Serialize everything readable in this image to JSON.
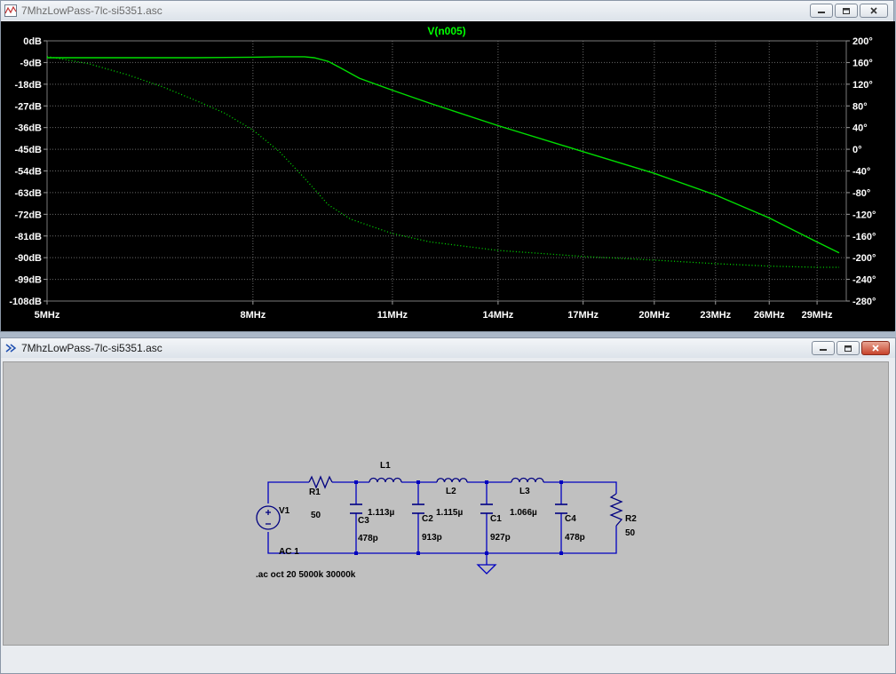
{
  "plot_window": {
    "title": "7MhzLowPass-7lc-si5351.asc",
    "trace_name": "V(n005)"
  },
  "schematic_window": {
    "title": "7MhzLowPass-7lc-si5351.asc"
  },
  "chart_data": {
    "type": "line",
    "title": "V(n005)",
    "x_scale": "log",
    "xlim_mhz": [
      5,
      31
    ],
    "x_ticks": [
      "5MHz",
      "8MHz",
      "11MHz",
      "14MHz",
      "17MHz",
      "20MHz",
      "23MHz",
      "26MHz",
      "29MHz"
    ],
    "y_left_ticks": [
      "0dB",
      "-9dB",
      "-18dB",
      "-27dB",
      "-36dB",
      "-45dB",
      "-54dB",
      "-63dB",
      "-72dB",
      "-81dB",
      "-90dB",
      "-99dB",
      "-108dB"
    ],
    "y_right_ticks": [
      "200°",
      "160°",
      "120°",
      "80°",
      "40°",
      "0°",
      "-40°",
      "-80°",
      "-120°",
      "-160°",
      "-200°",
      "-240°",
      "-280°"
    ],
    "ylim_db": [
      -108,
      0
    ],
    "ylim_deg": [
      -280,
      200
    ],
    "grid": true,
    "colors": {
      "background": "#000000",
      "grid": "#6a6a6a",
      "trace": "#00dd00",
      "text": "#ffffff",
      "title": "#00ff00"
    },
    "series": [
      {
        "style": "solid",
        "x_mhz": [
          5,
          6,
          7,
          8,
          8.5,
          9,
          9.2,
          9.5,
          9.8,
          10.2,
          11,
          12,
          14,
          17,
          20,
          23,
          26,
          29,
          30.5
        ],
        "y_db": [
          -7,
          -7,
          -7,
          -6.8,
          -6.6,
          -6.6,
          -7,
          -8.5,
          -11.5,
          -15.5,
          -20.5,
          -26,
          -35.2,
          -46,
          -55,
          -64,
          -73.5,
          -83.5,
          -88
        ]
      },
      {
        "style": "dotted",
        "x_mhz": [
          5,
          5.5,
          6,
          6.5,
          7,
          7.5,
          8,
          8.5,
          9,
          9.5,
          10,
          11,
          12,
          14,
          17,
          20,
          23,
          26,
          29,
          30.5
        ],
        "y_db": [
          -6.5,
          -9.5,
          -14,
          -19,
          -24.5,
          -30,
          -37,
          -46,
          -57,
          -68,
          -74,
          -80,
          -83.5,
          -87,
          -89.5,
          -91,
          -92.5,
          -93.5,
          -94,
          -94
        ]
      }
    ]
  },
  "schematic": {
    "components": {
      "V1": {
        "name": "V1",
        "value": "AC 1"
      },
      "R1": {
        "name": "R1",
        "value": "50"
      },
      "L1": {
        "name": "L1",
        "value": "1.113µ"
      },
      "L2": {
        "name": "L2",
        "value": "1.115µ"
      },
      "L3": {
        "name": "L3",
        "value": "1.066µ"
      },
      "C3": {
        "name": "C3",
        "value": "478p"
      },
      "C2": {
        "name": "C2",
        "value": "913p"
      },
      "C1": {
        "name": "C1",
        "value": "927p"
      },
      "C4": {
        "name": "C4",
        "value": "478p"
      },
      "R2": {
        "name": "R2",
        "value": "50"
      }
    },
    "directive": ".ac oct 20 5000k 30000k",
    "wire_color": "#0000c0",
    "part_color": "#000080"
  }
}
